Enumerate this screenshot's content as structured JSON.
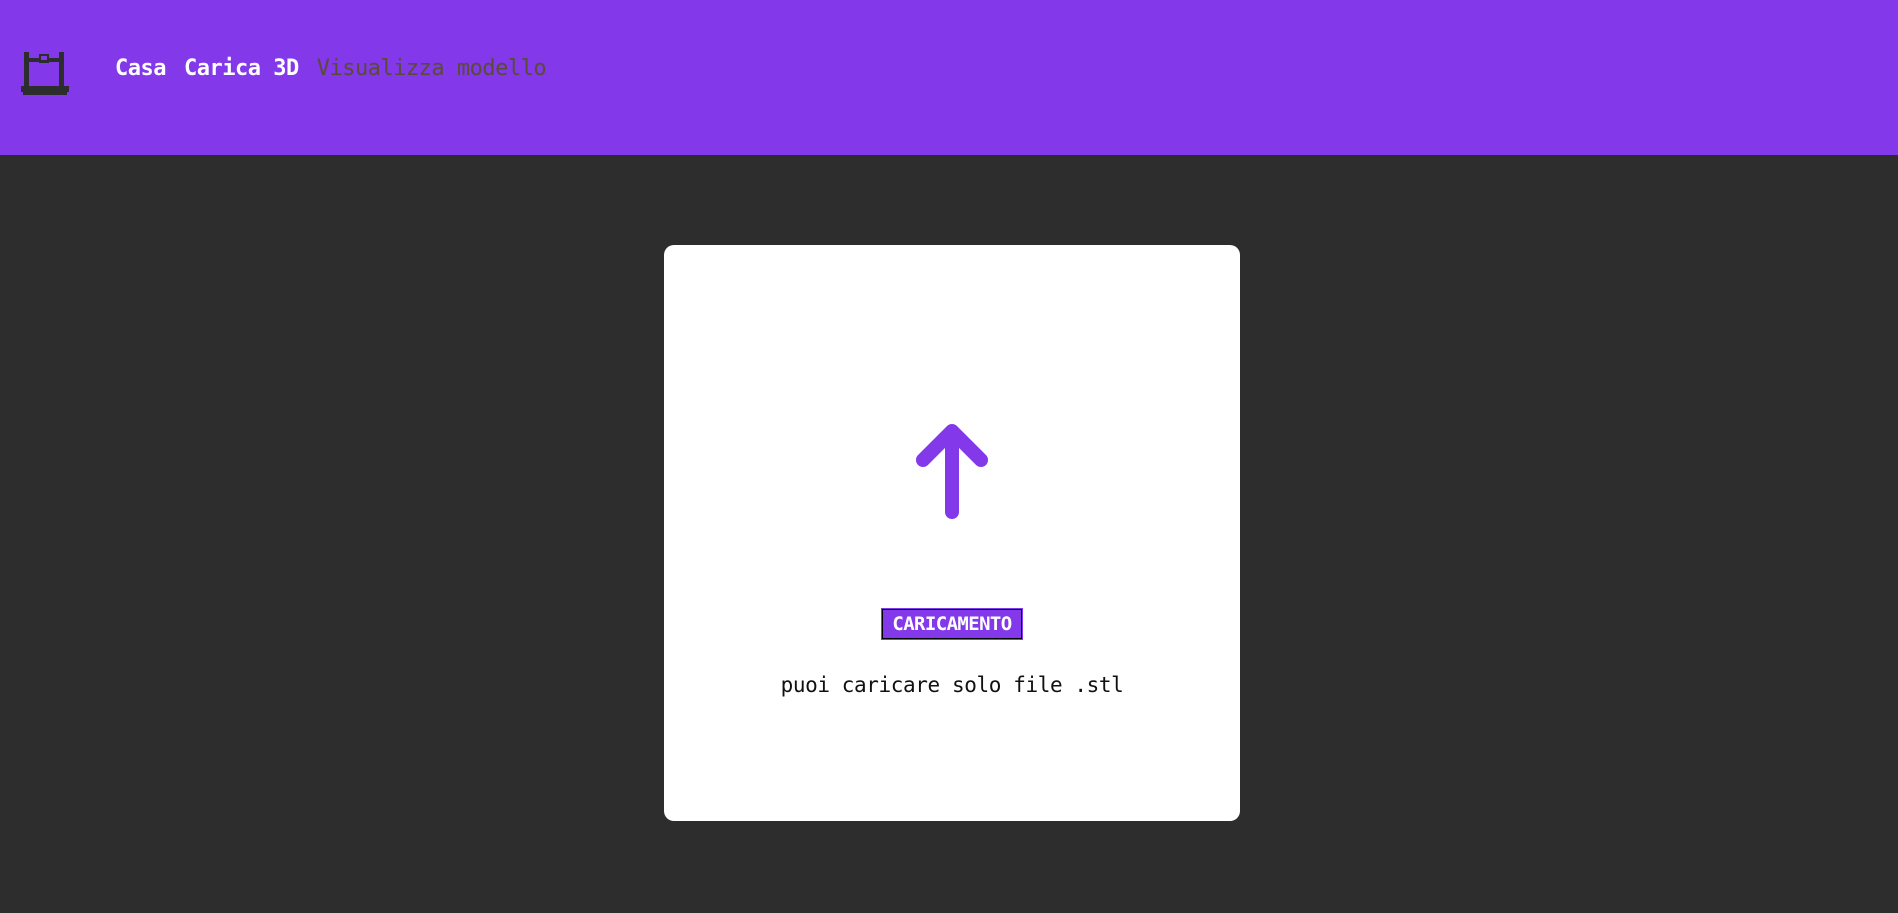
{
  "header": {
    "background": "#8338ea",
    "logo_icon": "3d-printer-icon",
    "nav": {
      "home": "Casa",
      "upload": "Carica 3D",
      "view_model": "Visualizza modello"
    }
  },
  "upload_card": {
    "arrow_icon": "upload-arrow-icon",
    "button_label": "CARICAMENTO",
    "hint": "puoi caricare solo file .stl",
    "accent": "#8338ea"
  },
  "page": {
    "background": "#2d2d2d"
  }
}
